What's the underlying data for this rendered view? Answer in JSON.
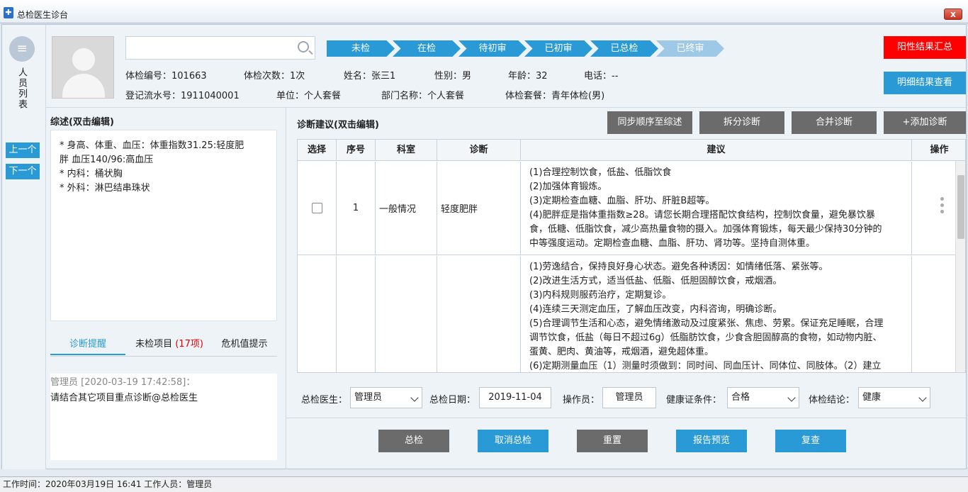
{
  "window": {
    "title": "总检医生诊台",
    "close_glyph": "x"
  },
  "rail": {
    "label": "人员列表",
    "prev": "上一个",
    "next": "下一个"
  },
  "search": {
    "placeholder": ""
  },
  "steps": [
    "未检",
    "在检",
    "待初审",
    "已初审",
    "已总检",
    "已终审"
  ],
  "info": {
    "exam_no": "体检编号：101663",
    "exam_count": "体检次数：1次",
    "name": "姓名：张三1",
    "gender": "性别：男",
    "age": "年龄：32",
    "phone": "电话：--",
    "reg_no": "登记流水号：1911040001",
    "unit": "单位：个人套餐",
    "dept": "部门名称：个人套餐",
    "package": "体检套餐：青年体检(男)"
  },
  "buttons": {
    "positive_summary": "阳性结果汇总",
    "detail_results": "明细结果查看"
  },
  "summary": {
    "title": "综述(双击编辑)",
    "lines": [
      "*   身高、体重、血压：体重指数31.25:轻度肥",
      "胖 血压140/96:高血压",
      "*   内科：桶状胸",
      "*   外科：淋巴结串珠状"
    ]
  },
  "tabs": {
    "reminder": "诊断提醒",
    "unchecked": "未检项目",
    "unchecked_count": "(17项)",
    "critical": "危机值提示"
  },
  "note": {
    "user": "管理员 [2020-03-19 17:42:58]：",
    "text": "请结合其它项目重点诊断@总检医生"
  },
  "diagnosis": {
    "title": "诊断建议(双击编辑)",
    "toolbar": {
      "sync": "同步顺序至综述",
      "split": "拆分诊断",
      "merge": "合并诊断",
      "add": "+添加诊断"
    },
    "columns": [
      "选择",
      "序号",
      "科室",
      "诊断",
      "建议",
      "操作"
    ],
    "rows": [
      {
        "seq": "1",
        "dept": "一般情况",
        "diag": "轻度肥胖",
        "advice": [
          "(1)合理控制饮食，低盐、低脂饮食",
          "(2)加强体育锻炼。",
          "(3)定期检查血糖、血脂、肝功、肝脏B超等。",
          "(4)肥胖症是指体重指数≥28。请您长期合理搭配饮食结构，控制饮食量，避免暴饮暴",
          "食，低糖、低脂饮食，减少高热量食物的摄入。加强体育锻炼，每天最少保持30分钟的",
          "中等强度运动。定期检查血糖、血脂、肝功、肾功等。坚持自测体重。"
        ]
      },
      {
        "seq": "",
        "dept": "",
        "diag": "",
        "advice": [
          "(1)劳逸结合，保持良好身心状态。避免各种诱因：如情绪低落、紧张等。",
          "(2)改进生活方式，适当低盐、低脂、低胆固醇饮食，戒烟酒。",
          "(3)内科规则服药治疗，定期复诊。",
          "(4)连续三天测定血压，了解血压改变，内科咨询，明确诊断。",
          "(5)合理调节生活和心态，避免情绪激动及过度紧张、焦虑、劳累。保证充足睡眠，合理",
          "调节饮食，低盐（每日不超过6g）低脂肪饮食，少食含胆固醇高的食物，如动物内脏、",
          "蛋黄、肥肉、黄油等，戒烟酒，避免超体重。",
          "(6)定期测量血压（1）测量时须做到：同时间、同血压计、同体位、同肢体。（2）建立"
        ]
      }
    ]
  },
  "form": {
    "doctor_label": "总检医生：",
    "doctor_value": "管理员",
    "date_label": "总检日期：",
    "date_value": "2019-11-04",
    "operator_label": "操作员：",
    "operator_value": "管理员",
    "health_label": "健康证条件：",
    "health_value": "合格",
    "conclusion_label": "体检结论：",
    "conclusion_value": "健康"
  },
  "actions": {
    "final": "总检",
    "cancel": "取消总检",
    "reset": "重置",
    "preview": "报告预览",
    "recheck": "复查"
  },
  "status": {
    "text": "工作时间：2020年03月19日 16:41 工作人员：管理员"
  },
  "colors": {
    "accent_blue": "#2a9ad6",
    "alert_red": "#ff0000",
    "button_gray": "#6b6b6b"
  }
}
